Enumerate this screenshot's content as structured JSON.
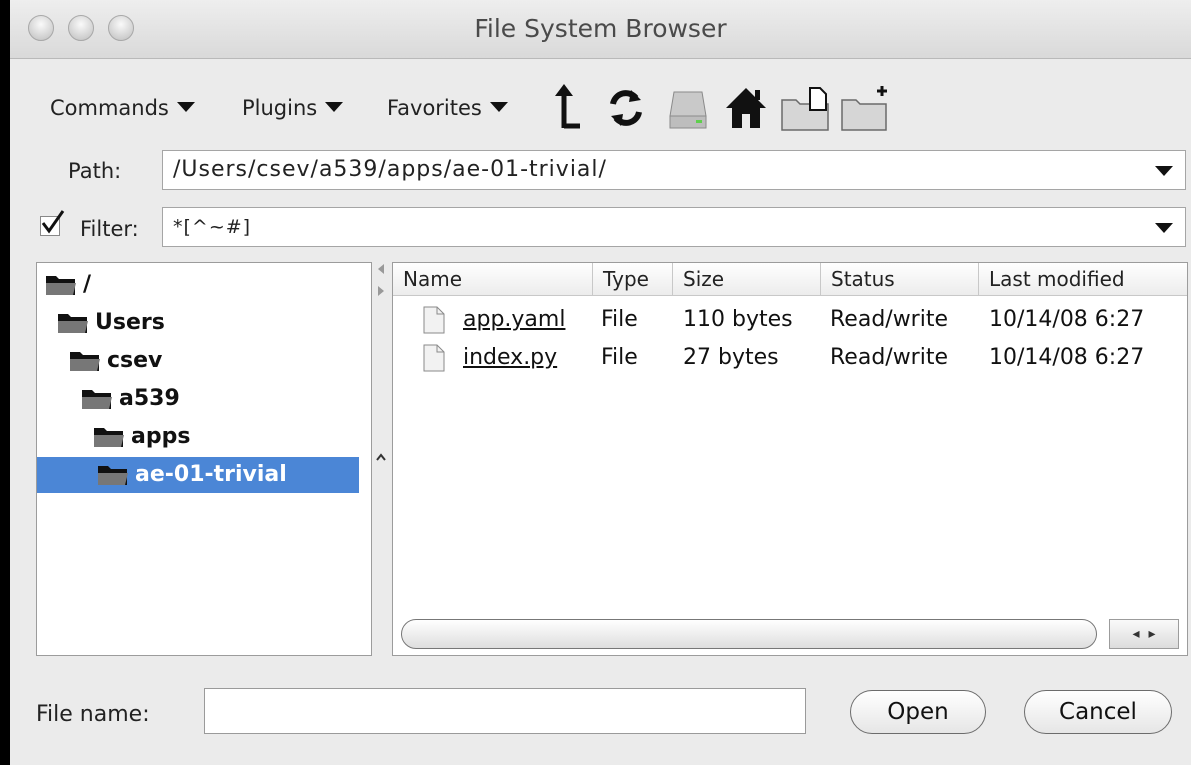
{
  "window": {
    "title": "File System Browser"
  },
  "toolbar": {
    "commands_label": "Commands",
    "plugins_label": "Plugins",
    "favorites_label": "Favorites",
    "icons": [
      "parent-directory-icon",
      "reload-icon",
      "drive-icon",
      "home-icon",
      "new-file-icon",
      "new-folder-icon"
    ]
  },
  "path": {
    "label": "Path:",
    "value": "/Users/csev/a539/apps/ae-01-trivial/"
  },
  "filter": {
    "label": "Filter:",
    "checked": true,
    "value": "*[^~#]"
  },
  "tree": {
    "items": [
      {
        "label": "/",
        "depth": 0,
        "selected": false
      },
      {
        "label": "Users",
        "depth": 1,
        "selected": false
      },
      {
        "label": "csev",
        "depth": 2,
        "selected": false
      },
      {
        "label": "a539",
        "depth": 3,
        "selected": false
      },
      {
        "label": "apps",
        "depth": 4,
        "selected": false
      },
      {
        "label": "ae-01-trivial",
        "depth": 5,
        "selected": true
      }
    ]
  },
  "file_table": {
    "columns": [
      "Name",
      "Type",
      "Size",
      "Status",
      "Last modified"
    ],
    "rows": [
      {
        "name": "app.yaml",
        "type": "File",
        "size": "110 bytes",
        "status": "Read/write",
        "modified": "10/14/08 6:27"
      },
      {
        "name": "index.py",
        "type": "File",
        "size": "27 bytes",
        "status": "Read/write",
        "modified": "10/14/08 6:27"
      }
    ]
  },
  "footer": {
    "file_name_label": "File name:",
    "file_name_value": "",
    "open_label": "Open",
    "cancel_label": "Cancel"
  },
  "colors": {
    "selection": "#4b86d6",
    "window_bg": "#ebebeb"
  }
}
